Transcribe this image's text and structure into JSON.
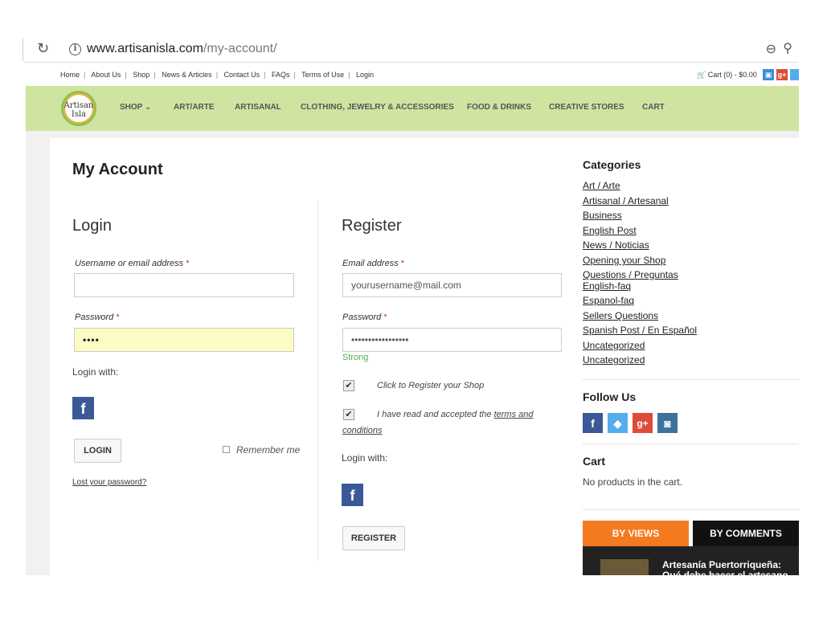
{
  "browser": {
    "reload_icon": "↻",
    "info_icon": "i",
    "url_host": "www.artisanisla.com",
    "url_path": "/my-account/",
    "zoom_icon": "⊖",
    "extension_icon": "⚲"
  },
  "topbar": {
    "links": [
      "Home",
      "About Us",
      "Shop",
      "News & Articles",
      "Contact Us",
      "FAQs",
      "Terms of Use",
      "Login"
    ],
    "separator": "|",
    "cart": "Cart (0) - $0.00",
    "cart_icon": "cart-icon",
    "social_colors": [
      "#3a8ed8",
      "#dd4b39",
      "#55acee"
    ]
  },
  "header": {
    "logo_line1": "Artisan",
    "logo_line2": "Isla",
    "nav": [
      "SHOP ⌄",
      "ART/ARTE",
      "ARTISANAL",
      "CLOTHING, JEWELRY & ACCESSORIES",
      "FOOD & DRINKS",
      "CREATIVE STORES",
      "CART"
    ],
    "bg_color": "#cfe4a1"
  },
  "page": {
    "title": "My Account"
  },
  "login": {
    "heading": "Login",
    "username_label": "Username or email address",
    "required_mark": "*",
    "username_value": "",
    "password_label": "Password",
    "password_value": "••••",
    "login_with": "Login with:",
    "facebook_glyph": "f",
    "button": "LOGIN",
    "remember": "Remember me",
    "lost": "Lost your password?"
  },
  "register": {
    "heading": "Register",
    "email_label": "Email address",
    "email_value": "yourusername@mail.com",
    "password_label": "Password",
    "password_value": "•••••••••••••••••",
    "strength": "Strong",
    "check1": "Click to Register your Shop",
    "check2_prefix": "I have read and accepted the",
    "check2_link1": "terms and",
    "check2_link2": "conditions",
    "check_mark": "✔",
    "login_with": "Login with:",
    "facebook_glyph": "f",
    "button": "REGISTER"
  },
  "sidebar": {
    "categories_title": "Categories",
    "categories": [
      "Art / Arte",
      "Artisanal / Artesanal",
      "Business",
      "English Post",
      "News / Noticias",
      "Opening your Shop",
      "Questions / Preguntas",
      "English-faq",
      "Espanol-faq",
      "Sellers Questions",
      "Spanish Post / En Español",
      "Uncategorized",
      "Uncategorized"
    ],
    "follow_title": "Follow Us",
    "follow_icons": [
      {
        "glyph": "f",
        "color": "#3b5998"
      },
      {
        "glyph": "t",
        "color": "#55acee"
      },
      {
        "glyph": "g+",
        "color": "#dd4b39"
      },
      {
        "glyph": "◙",
        "color": "#3f729b"
      }
    ],
    "cart_title": "Cart",
    "cart_empty": "No products in the cart.",
    "tab_views": "BY VIEWS",
    "tab_comments": "BY COMMENTS",
    "post_title": "Artesanía Puertorriqueña: Qué debe hacer el artesano"
  }
}
